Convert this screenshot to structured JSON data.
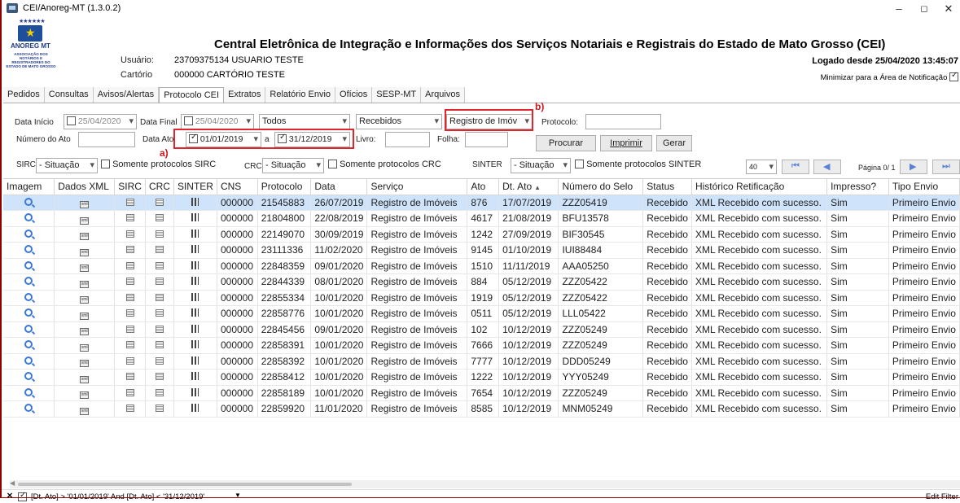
{
  "window": {
    "title": "CEI/Anoreg-MT (1.3.0.2)",
    "minimize": "–",
    "maximize": "◻",
    "close": "✕"
  },
  "header": {
    "logo_stars": "★★★★★★",
    "logo_org": "ANOREG MT",
    "logo_sub": "ASSOCIAÇÃO DOS NOTÁRIOS E REGISTRADORES DO ESTADO DE MATO GROSSO",
    "main_title": "Central Eletrônica de Integração e Informações dos Serviços Notariais e Registrais do Estado de Mato Grosso (CEI)",
    "user_label": "Usuário:",
    "user_value": "23709375134 USUARIO TESTE",
    "office_label": "Cartório",
    "office_value": "000000 CARTÓRIO TESTE",
    "logged": "Logado desde 25/04/2020 13:45:07",
    "minimize_tray": "Minimizar para a Área de Notificação"
  },
  "tabs": [
    "Pedidos",
    "Consultas",
    "Avisos/Alertas",
    "Protocolo CEI",
    "Extratos",
    "Relatório Envio",
    "Ofícios",
    "SESP-MT",
    "Arquivos"
  ],
  "filters": {
    "start_label": "Data Início",
    "start_value": "25/04/2020",
    "end_label": "Data Final",
    "end_value": "25/04/2020",
    "todos": "Todos",
    "recebidos": "Recebidos",
    "registro": "Registro de Imóv",
    "protocolo_label": "Protocolo:",
    "numero_ato_label": "Número do Ato",
    "data_ato_label": "Data Ato",
    "ato_from": "01/01/2019",
    "ato_sep": "a",
    "ato_to": "31/12/2019",
    "livro_label": "Livro:",
    "folha_label": "Folha:",
    "procurar": "Procurar",
    "imprimir": "Imprimir",
    "gerar": "Gerar",
    "annot_a": "a)",
    "annot_b": "b)"
  },
  "status_row": {
    "sirc_label": "SIRC",
    "sirc_value": "- Situação",
    "sirc_only": "Somente protocolos SIRC",
    "crc_label": "CRC",
    "crc_value": "- Situação",
    "crc_only": "Somente protocolos CRC",
    "sinter_label": "SINTER",
    "sinter_value": "- Situação",
    "sinter_only": "Somente protocolos SINTER",
    "page_size": "40",
    "page_text": "Página 0/ 1"
  },
  "columns": [
    "Imagem",
    "Dados XML",
    "SIRC",
    "CRC",
    "SINTER",
    "CNS",
    "Protocolo",
    "Data",
    "Serviço",
    "Ato",
    "Dt. Ato",
    "Número do Selo",
    "Status",
    "Histórico Retificação",
    "Impresso?",
    "Tipo Envio"
  ],
  "rows": [
    [
      "000000",
      "21545883",
      "26/07/2019",
      "Registro de Imóveis",
      "876",
      "17/07/2019",
      "ZZZ05419",
      "Recebido",
      "XML Recebido com sucesso.",
      "Sim",
      "Primeiro Envio"
    ],
    [
      "000000",
      "21804800",
      "22/08/2019",
      "Registro de Imóveis",
      "4617",
      "21/08/2019",
      "BFU13578",
      "Recebido",
      "XML Recebido com sucesso.",
      "Sim",
      "Primeiro Envio"
    ],
    [
      "000000",
      "22149070",
      "30/09/2019",
      "Registro de Imóveis",
      "1242",
      "27/09/2019",
      "BIF30545",
      "Recebido",
      "XML Recebido com sucesso.",
      "Sim",
      "Primeiro Envio"
    ],
    [
      "000000",
      "23111336",
      "11/02/2020",
      "Registro de Imóveis",
      "9145",
      "01/10/2019",
      "IUI88484",
      "Recebido",
      "XML Recebido com sucesso.",
      "Sim",
      "Primeiro Envio"
    ],
    [
      "000000",
      "22848359",
      "09/01/2020",
      "Registro de Imóveis",
      "1510",
      "11/11/2019",
      "AAA05250",
      "Recebido",
      "XML Recebido com sucesso.",
      "Sim",
      "Primeiro Envio"
    ],
    [
      "000000",
      "22844339",
      "08/01/2020",
      "Registro de Imóveis",
      "884",
      "05/12/2019",
      "ZZZ05422",
      "Recebido",
      "XML Recebido com sucesso.",
      "Sim",
      "Primeiro Envio"
    ],
    [
      "000000",
      "22855334",
      "10/01/2020",
      "Registro de Imóveis",
      "1919",
      "05/12/2019",
      "ZZZ05422",
      "Recebido",
      "XML Recebido com sucesso.",
      "Sim",
      "Primeiro Envio"
    ],
    [
      "000000",
      "22858776",
      "10/01/2020",
      "Registro de Imóveis",
      "0511",
      "05/12/2019",
      "LLL05422",
      "Recebido",
      "XML Recebido com sucesso.",
      "Sim",
      "Primeiro Envio"
    ],
    [
      "000000",
      "22845456",
      "09/01/2020",
      "Registro de Imóveis",
      "102",
      "10/12/2019",
      "ZZZ05249",
      "Recebido",
      "XML Recebido com sucesso.",
      "Sim",
      "Primeiro Envio"
    ],
    [
      "000000",
      "22858391",
      "10/01/2020",
      "Registro de Imóveis",
      "7666",
      "10/12/2019",
      "ZZZ05249",
      "Recebido",
      "XML Recebido com sucesso.",
      "Sim",
      "Primeiro Envio"
    ],
    [
      "000000",
      "22858392",
      "10/01/2020",
      "Registro de Imóveis",
      "7777",
      "10/12/2019",
      "DDD05249",
      "Recebido",
      "XML Recebido com sucesso.",
      "Sim",
      "Primeiro Envio"
    ],
    [
      "000000",
      "22858412",
      "10/01/2020",
      "Registro de Imóveis",
      "1222",
      "10/12/2019",
      "YYY05249",
      "Recebido",
      "XML Recebido com sucesso.",
      "Sim",
      "Primeiro Envio"
    ],
    [
      "000000",
      "22858189",
      "10/01/2020",
      "Registro de Imóveis",
      "7654",
      "10/12/2019",
      "ZZZ05249",
      "Recebido",
      "XML Recebido com sucesso.",
      "Sim",
      "Primeiro Envio"
    ],
    [
      "000000",
      "22859920",
      "11/01/2020",
      "Registro de Imóveis",
      "8585",
      "10/12/2019",
      "MNM05249",
      "Recebido",
      "XML Recebido com sucesso.",
      "Sim",
      "Primeiro Envio"
    ]
  ],
  "footer": {
    "filter_text": "[Dt. Ato] > '01/01/2019' And [Dt. Ato] < '31/12/2019'",
    "edit_filter": "Edit Filter"
  },
  "colors": {
    "selected_row": "#cfe3fb",
    "highlight": "#e0252d",
    "frame": "#8b0000"
  }
}
